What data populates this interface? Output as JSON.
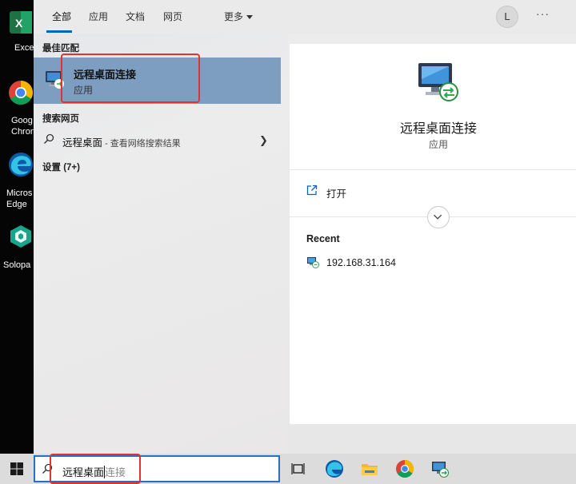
{
  "desktop": {
    "icons": [
      {
        "label": "Exce",
        "icon": "excel-icon"
      },
      {
        "label": "Goog\nChron",
        "icon": "chrome-icon"
      },
      {
        "label": "Micros\nEdge",
        "icon": "edge-icon"
      },
      {
        "label": "Solopa",
        "icon": "solopace-icon"
      }
    ]
  },
  "tabs": {
    "all": "全部",
    "apps": "应用",
    "docs": "文档",
    "web": "网页",
    "more": "更多"
  },
  "user": {
    "avatar_letter": "L"
  },
  "menu": {
    "more_dots": "···"
  },
  "results": {
    "best_match_header": "最佳匹配",
    "best_match": {
      "title": "远程桌面连接",
      "subtitle": "应用"
    },
    "search_web_header": "搜索网页",
    "web_suggestion": {
      "query": "远程桌面",
      "hint": " - 查看网络搜索结果"
    },
    "settings_header": "设置 (7+)"
  },
  "detail": {
    "name": "远程桌面连接",
    "kind": "应用",
    "open_label": "打开",
    "recent_header": "Recent",
    "recent_items": [
      {
        "label": "192.168.31.164"
      }
    ]
  },
  "search": {
    "typed": "远程桌面",
    "ghost": "连接"
  },
  "colors": {
    "accent": "#0067c0",
    "highlight": "#e2332d",
    "selected_row": "#7d9ec0"
  }
}
